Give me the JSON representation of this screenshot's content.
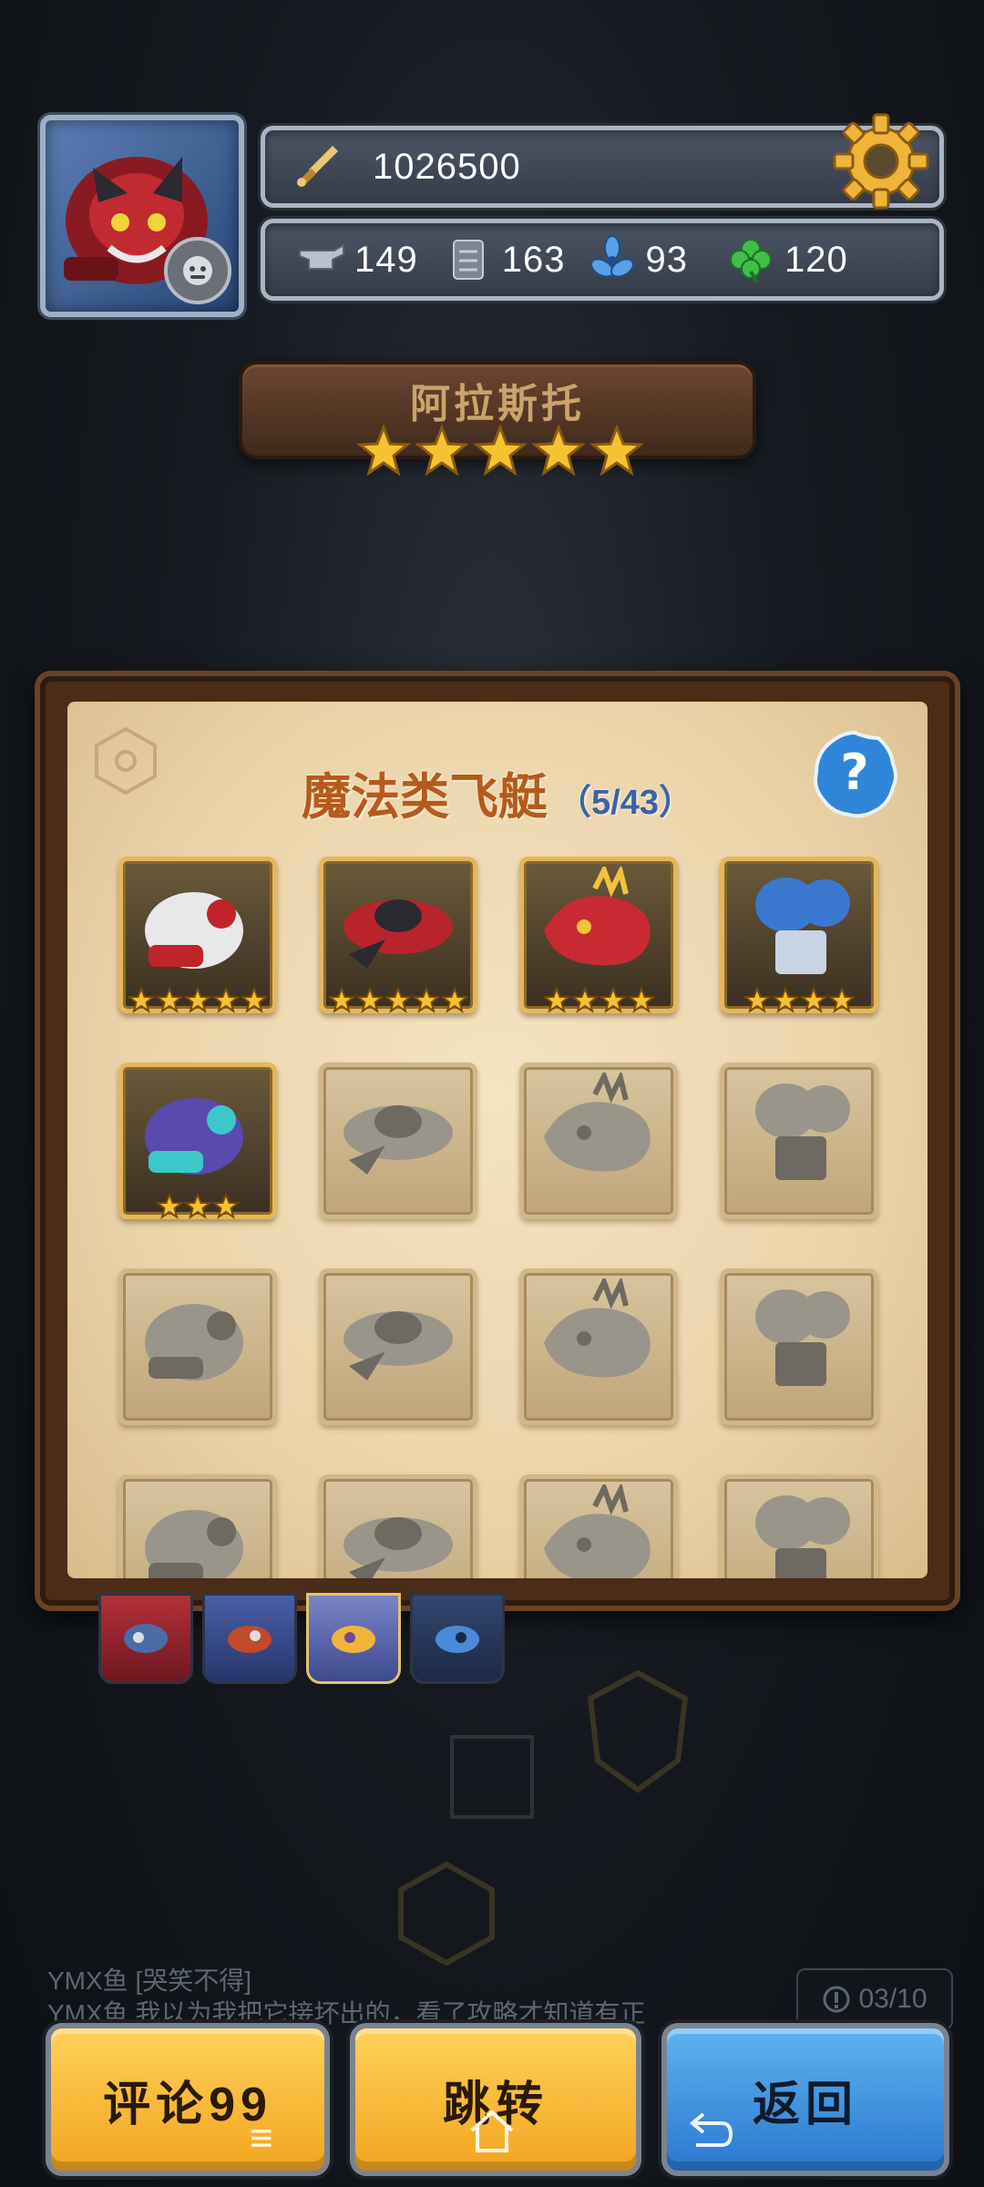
{
  "player": {
    "power": "1026500",
    "resources": [
      {
        "icon": "anvil-icon",
        "value": "149"
      },
      {
        "icon": "scroll-icon",
        "value": "163"
      },
      {
        "icon": "propeller-icon",
        "value": "93"
      },
      {
        "icon": "clover-icon",
        "value": "120"
      }
    ]
  },
  "stage": {
    "name": "阿拉斯托",
    "stars": 5
  },
  "panel": {
    "title": "魔法类飞艇",
    "count": "（5/43）"
  },
  "ships": [
    {
      "name": "white-drill-airship",
      "owned": true,
      "stars": 5
    },
    {
      "name": "red-beast-airship",
      "owned": true,
      "stars": 5
    },
    {
      "name": "red-dragon-airship",
      "owned": true,
      "stars": 4
    },
    {
      "name": "blue-mech-airship",
      "owned": true,
      "stars": 4
    },
    {
      "name": "purple-crystal-airship",
      "owned": true,
      "stars": 3
    },
    {
      "name": "saucer-airship",
      "owned": false,
      "stars": 0
    },
    {
      "name": "spiked-rock-airship",
      "owned": false,
      "stars": 0
    },
    {
      "name": "balloon-tower-airship",
      "owned": false,
      "stars": 0
    },
    {
      "name": "round-claw-airship",
      "owned": false,
      "stars": 0
    },
    {
      "name": "claw-mech-airship",
      "owned": false,
      "stars": 0
    },
    {
      "name": "fortress-cloud-airship",
      "owned": false,
      "stars": 0
    },
    {
      "name": "tribal-mask-airship",
      "owned": false,
      "stars": 0
    },
    {
      "name": "castle-airship",
      "owned": false,
      "stars": 0
    },
    {
      "name": "helmet-airship",
      "owned": false,
      "stars": 0
    },
    {
      "name": "block-airship",
      "owned": false,
      "stars": 0
    },
    {
      "name": "dome-airship",
      "owned": false,
      "stars": 0
    }
  ],
  "chat": {
    "line1": "YMX鱼 [哭笑不得]",
    "line2": "YMX鱼 我以为我把它接坏出的，看了攻略才知道有正"
  },
  "counter": "03/10",
  "buttons": {
    "comment": "评论99",
    "jump": "跳转",
    "back": "返回"
  },
  "colors": {
    "accent_yellow": "#f2a51f",
    "accent_blue": "#2a78cf",
    "title_orange": "#b55a1c",
    "count_blue": "#3a63a8"
  }
}
